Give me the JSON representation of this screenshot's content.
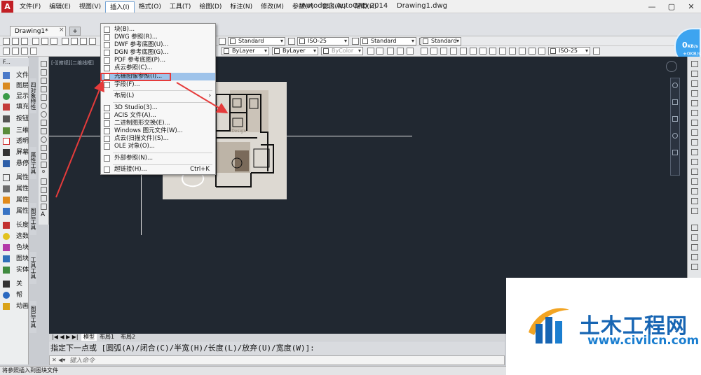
{
  "window": {
    "app_title": "Autodesk AutoCAD 2014",
    "file_title": "Drawing1.dwg",
    "controls": [
      "—",
      "▢",
      "✕"
    ]
  },
  "menubar": {
    "items": [
      "文件(F)",
      "编辑(E)",
      "视图(V)",
      "插入(I)",
      "格式(O)",
      "工具(T)",
      "绘图(D)",
      "标注(N)",
      "修改(M)",
      "参数(P)",
      "窗口(W)",
      "帮助(H)"
    ],
    "active_index": 3
  },
  "tabs": {
    "drawing": "Drawing1*",
    "close": "×",
    "new": "+"
  },
  "toolbar": {
    "text_style": "Standard",
    "dim_style": "ISO-25",
    "table_style": "Standard",
    "multileader_style": "Standard",
    "layer": "0",
    "linetype1": "ByLayer",
    "linetype2": "ByLayer",
    "color": "ByColor",
    "dim_style2": "ISO-25"
  },
  "net_speed": {
    "value": "0",
    "unit": "KB/s",
    "small": "+0KB/s"
  },
  "left_panel": {
    "header": "F...",
    "items": [
      "文件",
      "图层",
      "显示",
      "填充",
      "按钮",
      "三维",
      "透明",
      "屏幕",
      "悬停",
      "属性",
      "属性",
      "属性",
      "属性",
      "长度",
      "选数",
      "色块",
      "图块",
      "实体",
      "关",
      "帮",
      "动画"
    ],
    "section_titles": [
      "四对象特性",
      "属性工具",
      "图层工具",
      "工具工具",
      "图层工具"
    ]
  },
  "canvas": {
    "viewport_label": "[-][俯视][二维线框]"
  },
  "insert_menu": {
    "items": [
      {
        "label": "块(B)...",
        "shortcut": ""
      },
      {
        "label": "DWG 参照(R)...",
        "shortcut": ""
      },
      {
        "label": "DWF 参考底图(U)...",
        "shortcut": ""
      },
      {
        "label": "DGN 参考底图(G)...",
        "shortcut": ""
      },
      {
        "label": "PDF 参考底图(P)...",
        "shortcut": ""
      },
      {
        "label": "点云参照(C)...",
        "shortcut": ""
      },
      {
        "label": "光栅图像参照(I)...",
        "shortcut": ""
      },
      {
        "label": "字段(F)...",
        "shortcut": ""
      },
      {
        "label": "布局(L)",
        "shortcut": ""
      },
      {
        "label": "3D Studio(3)...",
        "shortcut": ""
      },
      {
        "label": "ACIS 文件(A)...",
        "shortcut": ""
      },
      {
        "label": "二进制图形交换(E)...",
        "shortcut": ""
      },
      {
        "label": "Windows 图元文件(W)...",
        "shortcut": ""
      },
      {
        "label": "点云(扫描文件)(S)...",
        "shortcut": ""
      },
      {
        "label": "OLE 对象(O)...",
        "shortcut": ""
      },
      {
        "label": "外部参照(N)...",
        "shortcut": ""
      },
      {
        "label": "超链接(H)...",
        "shortcut": "Ctrl+K"
      }
    ],
    "highlighted_index": 6,
    "submenu_arrow": "›"
  },
  "layout_tabs": {
    "nav": "|◀ ◀ ▶ ▶|",
    "items": [
      "模型",
      "布局1",
      "布局2"
    ]
  },
  "command": {
    "history": "指定下一点或 [圆弧(A)/闭合(C)/半宽(H)/长度(L)/放弃(U)/宽度(W)]:",
    "placeholder": "键入命令",
    "icons": "✕ ◀▾"
  },
  "statusbar": {
    "text": "将参照插入到图块文件"
  },
  "watermark": {
    "name": "土木工程网",
    "url": "www.civilcn.com"
  },
  "colors": {
    "canvas": "#212831",
    "highlight": "#9ec3ea",
    "annotation_red": "#e53b3b",
    "brand_blue": "#1765b3",
    "speed_badge": "#3da4f0"
  }
}
